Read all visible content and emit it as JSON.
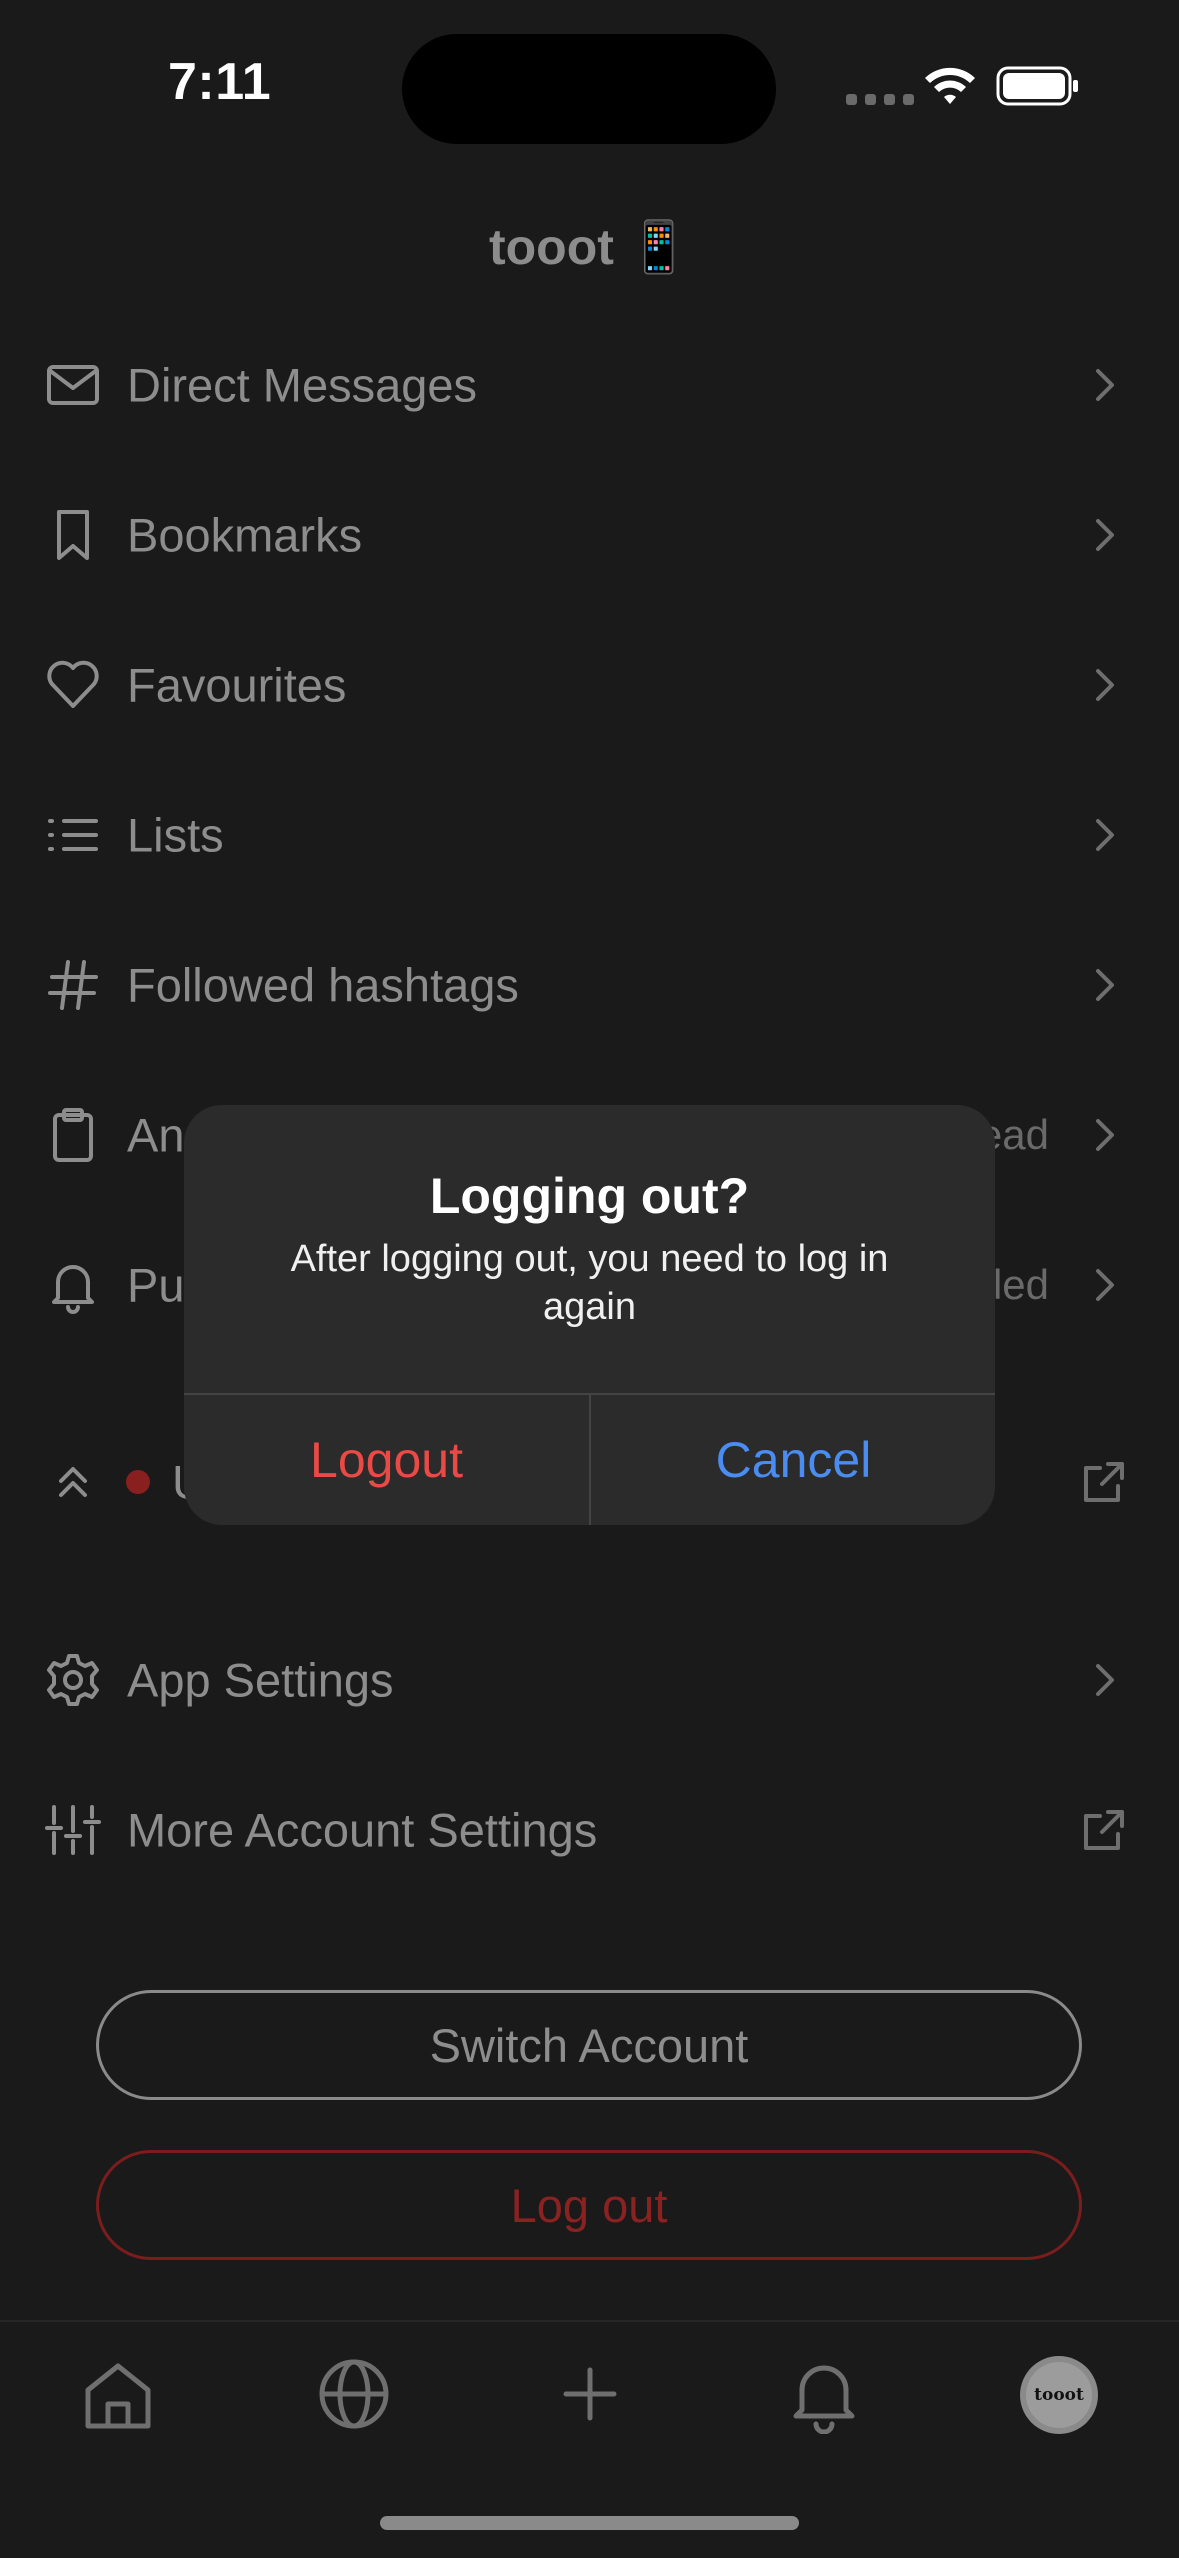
{
  "status_bar": {
    "time": "7:11"
  },
  "header": {
    "title": "tooot 📱"
  },
  "menu": {
    "items": [
      {
        "label": "Direct Messages",
        "icon": "mail-icon",
        "trailing": "chevron"
      },
      {
        "label": "Bookmarks",
        "icon": "bookmark-icon",
        "trailing": "chevron"
      },
      {
        "label": "Favourites",
        "icon": "heart-icon",
        "trailing": "chevron"
      },
      {
        "label": "Lists",
        "icon": "list-icon",
        "trailing": "chevron"
      },
      {
        "label": "Followed hashtags",
        "icon": "hash-icon",
        "trailing": "chevron"
      },
      {
        "label": "An",
        "icon": "clipboard-icon",
        "value": "ead",
        "trailing": "chevron"
      },
      {
        "label": "Pu",
        "icon": "bell-icon",
        "value": "led",
        "trailing": "chevron"
      },
      {
        "label": "U",
        "icon": "chevrons-up-icon",
        "trailing": "external"
      }
    ],
    "settings": [
      {
        "label": "App Settings",
        "icon": "gear-icon",
        "trailing": "chevron"
      },
      {
        "label": "More Account Settings",
        "icon": "sliders-icon",
        "trailing": "external"
      }
    ]
  },
  "account": {
    "switch_label": "Switch Account",
    "logout_label": "Log out"
  },
  "avatar": {
    "text": "tooot"
  },
  "alert": {
    "title": "Logging out?",
    "message": "After logging out, you need to log in again",
    "confirm_label": "Logout",
    "cancel_label": "Cancel"
  },
  "colors": {
    "background": "#1a1a1a",
    "destructive": "#ea4a45",
    "accent": "#4a8cf0"
  }
}
